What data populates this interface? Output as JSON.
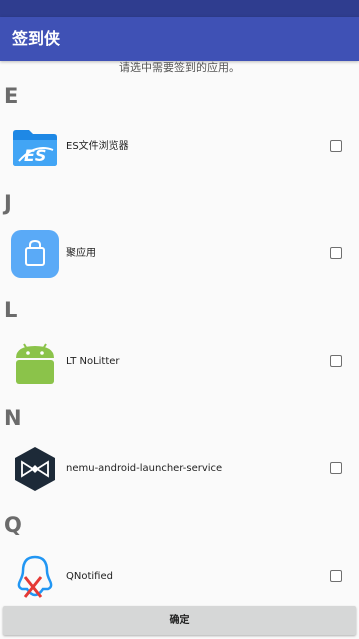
{
  "app_bar": {
    "title": "签到侠"
  },
  "hint": "请选中需要签到的应用。",
  "sections": [
    {
      "letter": "E",
      "apps": [
        {
          "name": "ES文件浏览器",
          "icon": "es-file-explorer-icon",
          "checked": false
        }
      ]
    },
    {
      "letter": "J",
      "apps": [
        {
          "name": "聚应用",
          "icon": "shopping-bag-icon",
          "checked": false
        }
      ]
    },
    {
      "letter": "L",
      "apps": [
        {
          "name": "LT NoLitter",
          "icon": "android-robot-icon",
          "checked": false
        }
      ]
    },
    {
      "letter": "N",
      "apps": [
        {
          "name": "nemu-android-launcher-service",
          "icon": "nemu-logo-icon",
          "checked": false
        }
      ]
    },
    {
      "letter": "Q",
      "apps": [
        {
          "name": "QNotified",
          "icon": "qq-penguin-crossed-icon",
          "checked": false
        }
      ]
    }
  ],
  "confirm_label": "确定",
  "colors": {
    "app_bar": "#3f51b5",
    "status_bar": "#2f3d8f",
    "background": "#fafafa",
    "button": "#d6d7d7"
  }
}
